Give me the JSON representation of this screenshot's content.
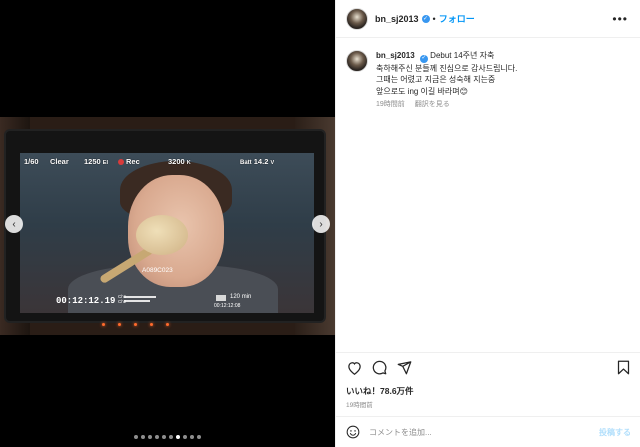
{
  "header": {
    "username": "bn_sj2013",
    "separator": "•",
    "follow_label": "フォロー",
    "more_icon": "more-horizontal-icon"
  },
  "caption": {
    "username": "bn_sj2013",
    "lines": [
      "Debut 14주년 자축",
      "축하해주신 분들께 진심으로 감사드립니다.",
      "그때는 어렸고 지금은 성숙해 지는중",
      "앞으로도 ing 이길 바라며😊"
    ],
    "time": "19時間前",
    "translate_label": "翻訳を見る"
  },
  "photo": {
    "hud": {
      "shutter": "1/60",
      "filter": "Clear",
      "iso": "1250",
      "iso_unit": "EI",
      "rec": "Rec",
      "kelvin": "3200",
      "kelvin_unit": "K",
      "batt_label": "Batt",
      "batt_value": "14.2",
      "batt_unit": "V",
      "clip": "A089C023",
      "timecode": "00:12:12.19",
      "meter_ch1": "Ch1",
      "meter_ch2": "Ch2",
      "remaining": "120",
      "remaining_unit": "min",
      "small_tc": "00:12:12:08"
    },
    "slide_count": 10,
    "active_slide": 6
  },
  "actions": {
    "like_icon": "heart-icon",
    "comment_icon": "comment-icon",
    "share_icon": "send-icon",
    "save_icon": "bookmark-icon"
  },
  "likes": {
    "text": "いいね！78.6万件"
  },
  "posted": "19時間前",
  "comment": {
    "placeholder": "コメントを追加...",
    "post_label": "投稿する",
    "emoji_icon": "emoji-icon"
  },
  "colors": {
    "accent": "#0095f6",
    "verified": "#3897f0",
    "post_disabled": "#b2dffc",
    "muted": "#8e8e8e",
    "text": "#262626"
  }
}
